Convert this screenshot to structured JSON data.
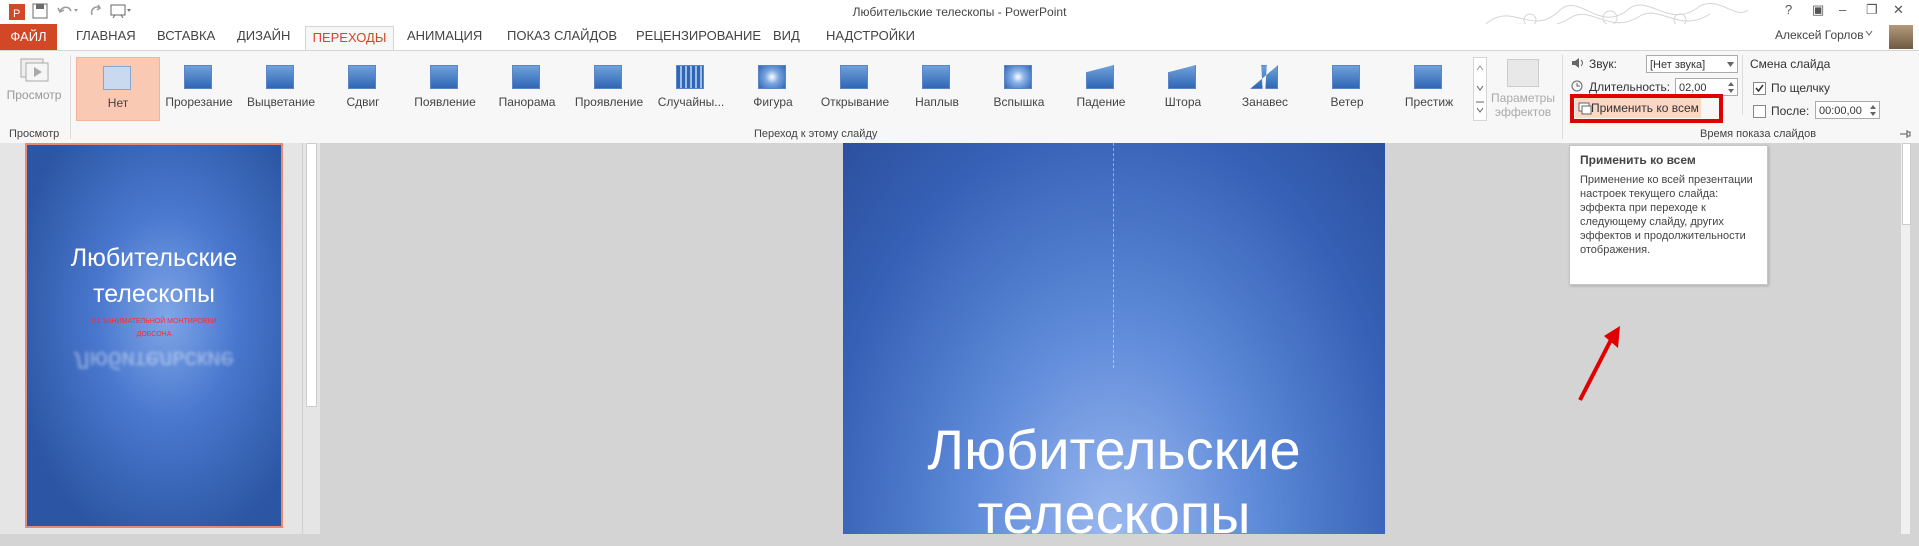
{
  "window": {
    "title": "Любительские телескопы - PowerPoint",
    "user": "Алексей Горлов",
    "help": "?"
  },
  "tabs": {
    "file": "ФАЙЛ",
    "items": [
      "ГЛАВНАЯ",
      "ВСТАВКА",
      "ДИЗАЙН",
      "ПЕРЕХОДЫ",
      "АНИМАЦИЯ",
      "ПОКАЗ СЛАЙДОВ",
      "РЕЦЕНЗИРОВАНИЕ",
      "ВИД",
      "НАДСТРОЙКИ"
    ],
    "active": "ПЕРЕХОДЫ"
  },
  "ribbon": {
    "preview_button": "Просмотр",
    "preview_group": "Просмотр",
    "transitions_group": "Переход к этому слайду",
    "timing_group": "Время показа слайдов",
    "transitions": [
      "Нет",
      "Прорезание",
      "Выцветание",
      "Сдвиг",
      "Появление",
      "Панорама",
      "Проявление",
      "Случайны...",
      "Фигура",
      "Открывание",
      "Наплыв",
      "Вспышка",
      "Падение",
      "Штора",
      "Занавес",
      "Ветер",
      "Престиж"
    ],
    "effect_params_line1": "Параметры",
    "effect_params_line2": "эффектов",
    "sound_label": "Звук:",
    "sound_value": "[Нет звука]",
    "duration_label": "Длительность:",
    "duration_value": "02,00",
    "apply_all": "Применить ко всем",
    "advance_label": "Смена слайда",
    "on_click_label": "По щелчку",
    "on_click_checked": true,
    "after_label": "После:",
    "after_value": "00:00,00",
    "highlight_color": "#e00000"
  },
  "tooltip": {
    "title": "Применить ко всем",
    "body": "Применение ко всей презентации настроек текущего слайда: эффекта при переходе к следующему слайду, других эффектов и продолжительности отображения."
  },
  "thumbnail": {
    "title": "Любительские телескопы",
    "subtitle_line1": "ИЗ ЗАНИМАТЕЛЬНОЙ МОНТИРОВКИ",
    "subtitle_line2": "ДОБСОНА",
    "reflection": "Любительские"
  },
  "slide": {
    "title_line1": "Любительские",
    "title_line2": "телескопы"
  },
  "colors": {
    "accent": "#d24726",
    "slide_blue": "#3661b6"
  }
}
